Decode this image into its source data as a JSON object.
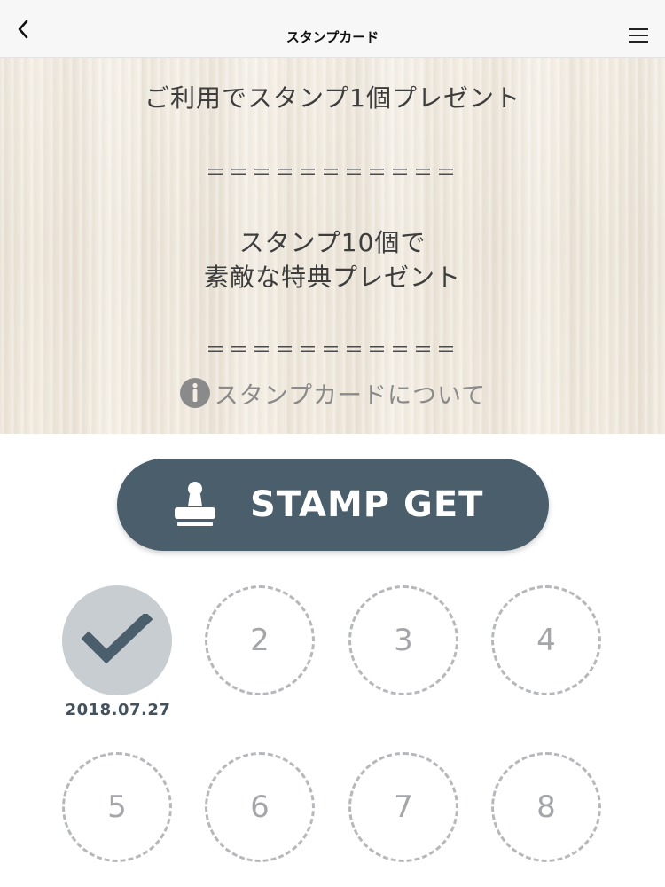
{
  "header": {
    "title": "スタンプカード",
    "back_icon": "chevron-left-icon",
    "menu_icon": "hamburger-menu-icon"
  },
  "banner": {
    "line1": "ご利用でスタンプ1個プレゼント",
    "separator": "＝＝＝＝＝＝＝＝＝＝＝",
    "line2": "スタンプ10個で",
    "line3": "素敵な特典プレゼント",
    "about_icon": "info-icon",
    "about_label": "スタンプカードについて"
  },
  "stamp_button": {
    "icon": "stamp-icon",
    "label": "STAMP GET",
    "color": "#4b5e6b"
  },
  "stamps": [
    {
      "label": "",
      "state": "done",
      "date": "2018.07.27",
      "icon": "checkmark-icon"
    },
    {
      "label": "2",
      "state": "empty"
    },
    {
      "label": "3",
      "state": "empty"
    },
    {
      "label": "4",
      "state": "empty"
    },
    {
      "label": "5",
      "state": "empty"
    },
    {
      "label": "6",
      "state": "empty"
    },
    {
      "label": "7",
      "state": "empty"
    },
    {
      "label": "8",
      "state": "empty"
    }
  ],
  "colors": {
    "accent": "#4b5e6b",
    "stamped_fill": "#c8cdd2",
    "empty_border": "#b6b8bb",
    "wood": "#f3ede2"
  }
}
